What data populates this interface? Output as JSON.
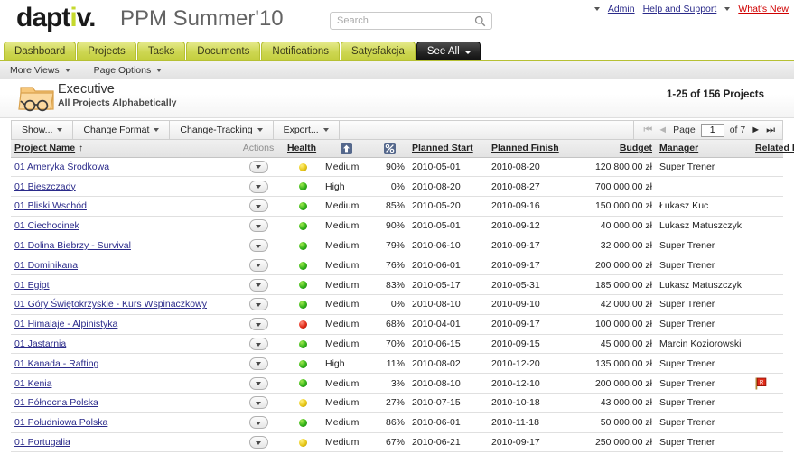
{
  "branding": {
    "logo_part1": "dapt",
    "logo_accent": "i",
    "logo_part2": "v",
    "logo_dot": ".",
    "product": "PPM Summer'10"
  },
  "search": {
    "value": "",
    "placeholder": "Search",
    "icon": "search-icon"
  },
  "topnav_right": {
    "user_label": "",
    "admin": "Admin",
    "help": "Help and Support",
    "whats_new": "What's New"
  },
  "tabs": [
    {
      "label": "Dashboard",
      "active": false
    },
    {
      "label": "Projects",
      "active": false
    },
    {
      "label": "Tasks",
      "active": false
    },
    {
      "label": "Documents",
      "active": false
    },
    {
      "label": "Notifications",
      "active": false
    },
    {
      "label": "Satysfakcja",
      "active": false
    },
    {
      "label": "See All",
      "active": true
    }
  ],
  "subnav": [
    {
      "label": "More Views"
    },
    {
      "label": "Page Options"
    }
  ],
  "page": {
    "icon": "folder-glasses-icon",
    "title": "Executive",
    "subtitle": "All Projects Alphabetically",
    "count": "1-25 of 156 Projects"
  },
  "toolbar": {
    "buttons": [
      {
        "label": "Show..."
      },
      {
        "label": "Change Format"
      },
      {
        "label": "Change-Tracking"
      },
      {
        "label": "Export..."
      }
    ],
    "pager": {
      "first_icon": "first-page-icon",
      "prev_icon": "prev-page-icon",
      "page_label": "Page",
      "page_value": "1",
      "of_label": "of 7",
      "next_icon": "next-page-icon",
      "last_icon": "last-page-icon"
    }
  },
  "table": {
    "columns": [
      {
        "key": "name",
        "label": "Project Name",
        "sorted": true,
        "sort_dir": "asc",
        "link": true
      },
      {
        "key": "actions",
        "label": "Actions",
        "sorted": false,
        "link": false
      },
      {
        "key": "health",
        "label": "Health",
        "sorted": false,
        "link": true
      },
      {
        "key": "priority",
        "label": "",
        "icon": "priority-up-icon",
        "link": false
      },
      {
        "key": "percent",
        "label": "",
        "icon": "percent-icon",
        "link": false
      },
      {
        "key": "pstart",
        "label": "Planned Start",
        "link": true
      },
      {
        "key": "pfinish",
        "label": "Planned Finish",
        "link": true
      },
      {
        "key": "budget",
        "label": "Budget",
        "link": true
      },
      {
        "key": "manager",
        "label": "Manager",
        "link": true
      },
      {
        "key": "related",
        "label": "Related Items",
        "link": true
      }
    ],
    "sort_arrow": "↑",
    "rows": [
      {
        "name": "01 Ameryka Środkowa",
        "health": "yellow",
        "priority": "Medium",
        "percent": "90%",
        "pstart": "2010-05-01",
        "pfinish": "2010-08-20",
        "budget": "120 800,00 zł",
        "manager": "Super Trener",
        "related": ""
      },
      {
        "name": "01 Bieszczady",
        "health": "green",
        "priority": "High",
        "percent": "0%",
        "pstart": "2010-08-20",
        "pfinish": "2010-08-27",
        "budget": "700 000,00 zł",
        "manager": "",
        "related": ""
      },
      {
        "name": "01 Bliski Wschód",
        "health": "green",
        "priority": "Medium",
        "percent": "85%",
        "pstart": "2010-05-20",
        "pfinish": "2010-09-16",
        "budget": "150 000,00 zł",
        "manager": "Łukasz Kuc",
        "related": ""
      },
      {
        "name": "01 Ciechocinek",
        "health": "green",
        "priority": "Medium",
        "percent": "90%",
        "pstart": "2010-05-01",
        "pfinish": "2010-09-12",
        "budget": "40 000,00 zł",
        "manager": "Lukasz Matuszczyk",
        "related": ""
      },
      {
        "name": "01 Dolina Biebrzy - Survival",
        "health": "green",
        "priority": "Medium",
        "percent": "79%",
        "pstart": "2010-06-10",
        "pfinish": "2010-09-17",
        "budget": "32 000,00 zł",
        "manager": "Super Trener",
        "related": ""
      },
      {
        "name": "01 Dominikana",
        "health": "green",
        "priority": "Medium",
        "percent": "76%",
        "pstart": "2010-06-01",
        "pfinish": "2010-09-17",
        "budget": "200 000,00 zł",
        "manager": "Super Trener",
        "related": ""
      },
      {
        "name": "01 Egipt",
        "health": "green",
        "priority": "Medium",
        "percent": "83%",
        "pstart": "2010-05-17",
        "pfinish": "2010-05-31",
        "budget": "185 000,00 zł",
        "manager": "Lukasz Matuszczyk",
        "related": ""
      },
      {
        "name": "01 Góry Świętokrzyskie - Kurs Wspinaczkowy",
        "health": "green",
        "priority": "Medium",
        "percent": "0%",
        "pstart": "2010-08-10",
        "pfinish": "2010-09-10",
        "budget": "42 000,00 zł",
        "manager": "Super Trener",
        "related": ""
      },
      {
        "name": "01 Himalaje - Alpinistyka",
        "health": "red",
        "priority": "Medium",
        "percent": "68%",
        "pstart": "2010-04-01",
        "pfinish": "2010-09-17",
        "budget": "100 000,00 zł",
        "manager": "Super Trener",
        "related": ""
      },
      {
        "name": "01 Jastarnia",
        "health": "green",
        "priority": "Medium",
        "percent": "70%",
        "pstart": "2010-06-15",
        "pfinish": "2010-09-15",
        "budget": "45 000,00 zł",
        "manager": "Marcin Koziorowski",
        "related": ""
      },
      {
        "name": "01 Kanada - Rafting",
        "health": "green",
        "priority": "High",
        "percent": "11%",
        "pstart": "2010-08-02",
        "pfinish": "2010-12-20",
        "budget": "135 000,00 zł",
        "manager": "Super Trener",
        "related": ""
      },
      {
        "name": "01 Kenia",
        "health": "green",
        "priority": "Medium",
        "percent": "3%",
        "pstart": "2010-08-10",
        "pfinish": "2010-12-10",
        "budget": "200 000,00 zł",
        "manager": "Super Trener",
        "related": "red-flag-icon"
      },
      {
        "name": "01 Północna Polska",
        "health": "yellow",
        "priority": "Medium",
        "percent": "27%",
        "pstart": "2010-07-15",
        "pfinish": "2010-10-18",
        "budget": "43 000,00 zł",
        "manager": "Super Trener",
        "related": ""
      },
      {
        "name": "01 Południowa Polska",
        "health": "green",
        "priority": "Medium",
        "percent": "86%",
        "pstart": "2010-06-01",
        "pfinish": "2010-11-18",
        "budget": "50 000,00 zł",
        "manager": "Super Trener",
        "related": ""
      },
      {
        "name": "01 Portugalia",
        "health": "yellow",
        "priority": "Medium",
        "percent": "67%",
        "pstart": "2010-06-21",
        "pfinish": "2010-09-17",
        "budget": "250 000,00 zł",
        "manager": "Super Trener",
        "related": ""
      }
    ]
  },
  "colors": {
    "tab_active_bg": "#1a1a1a",
    "tab_bg": "#cdd651",
    "link": "#2a2a8a",
    "alert": "#d00000",
    "health_green": "#33b21a",
    "health_yellow": "#e8c81a",
    "health_red": "#e02b18"
  }
}
